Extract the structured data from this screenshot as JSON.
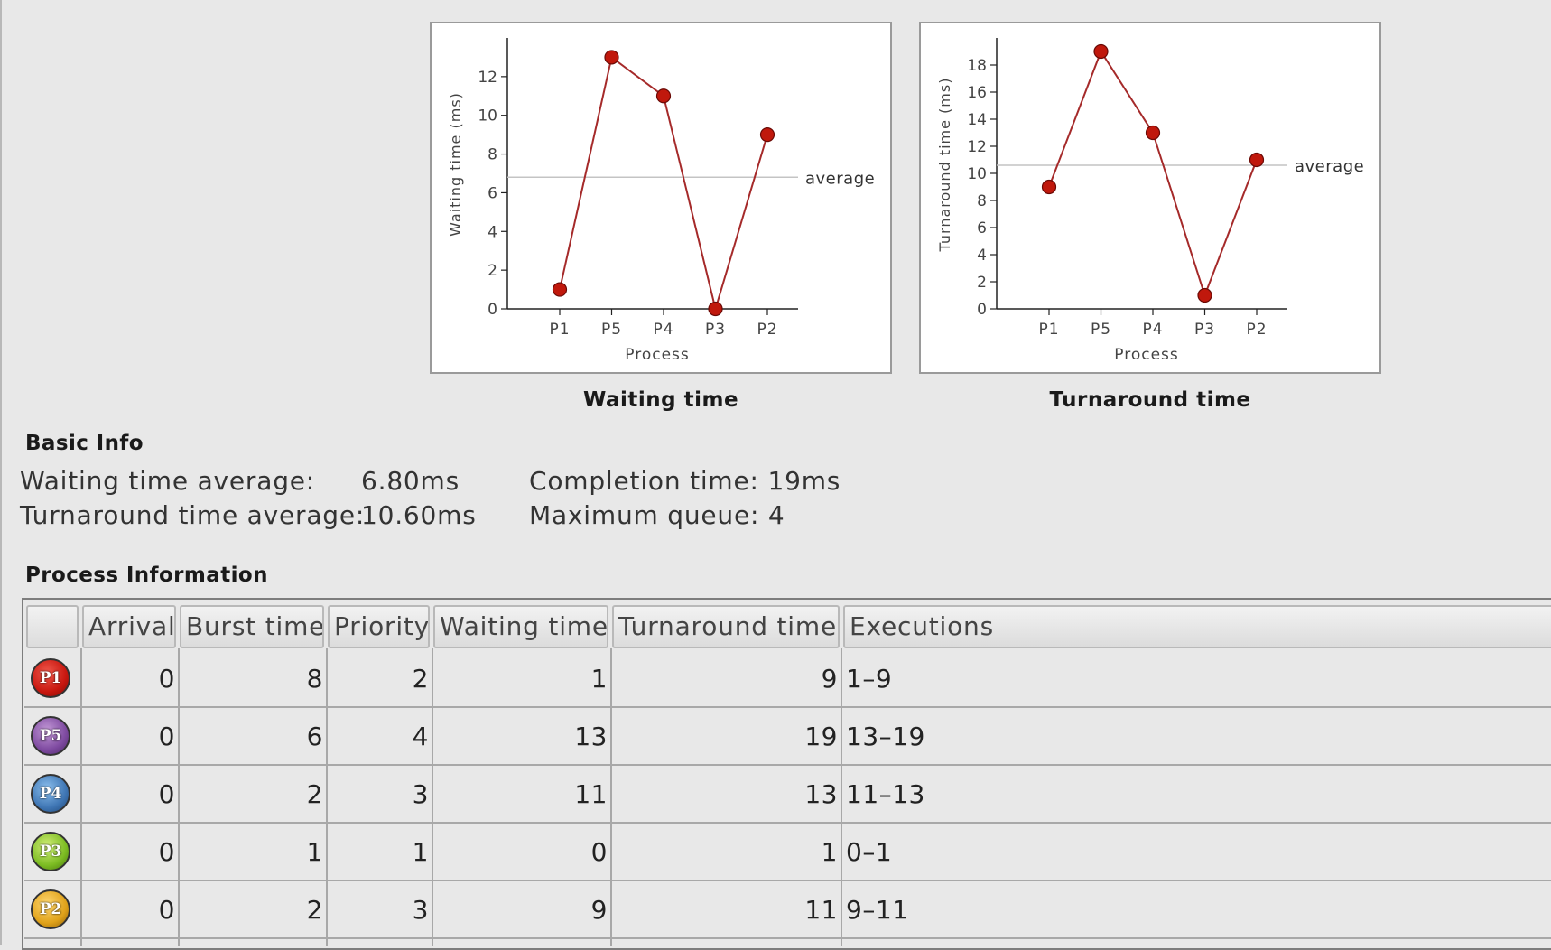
{
  "charts": [
    {
      "caption": "Waiting time",
      "average_label": "average",
      "chart_data": {
        "type": "line",
        "categories": [
          "P1",
          "P5",
          "P4",
          "P3",
          "P2"
        ],
        "values": [
          1,
          13,
          11,
          0,
          9
        ],
        "average": 6.8,
        "xlabel": "Process",
        "ylabel": "Waiting time (ms)",
        "ylim": [
          0,
          14
        ],
        "yticks": [
          0,
          2,
          4,
          6,
          8,
          10,
          12
        ],
        "line_color": "#a52a2a",
        "marker_color": "#c0180c"
      }
    },
    {
      "caption": "Turnaround time",
      "average_label": "average",
      "chart_data": {
        "type": "line",
        "categories": [
          "P1",
          "P5",
          "P4",
          "P3",
          "P2"
        ],
        "values": [
          9,
          19,
          13,
          1,
          11
        ],
        "average": 10.6,
        "xlabel": "Process",
        "ylabel": "Turnaround time (ms)",
        "ylim": [
          0,
          20
        ],
        "yticks": [
          0,
          2,
          4,
          6,
          8,
          10,
          12,
          14,
          16,
          18
        ],
        "line_color": "#a52a2a",
        "marker_color": "#c0180c"
      }
    }
  ],
  "basic_info": {
    "title": "Basic Info",
    "waiting_avg_label": "Waiting time average:",
    "waiting_avg_value": "6.80ms",
    "turnaround_avg_label": "Turnaround time average:",
    "turnaround_avg_value": "10.60ms",
    "completion_time": "Completion time: 19ms",
    "max_queue": "Maximum queue: 4"
  },
  "process_info": {
    "title": "Process Information",
    "headers": [
      "",
      "Arrival",
      "Burst time",
      "Priority",
      "Waiting time",
      "Turnaround time",
      "Executions"
    ],
    "rows": [
      {
        "id": "P1",
        "color": "#c8170f",
        "arrival": "0",
        "burst": "8",
        "priority": "2",
        "waiting": "1",
        "turnaround": "9",
        "executions": "1–9"
      },
      {
        "id": "P5",
        "color": "#7e4aa0",
        "arrival": "0",
        "burst": "6",
        "priority": "4",
        "waiting": "13",
        "turnaround": "19",
        "executions": "13–19"
      },
      {
        "id": "P4",
        "color": "#3f76b4",
        "arrival": "0",
        "burst": "2",
        "priority": "3",
        "waiting": "11",
        "turnaround": "13",
        "executions": "11–13"
      },
      {
        "id": "P3",
        "color": "#7cbc22",
        "arrival": "0",
        "burst": "1",
        "priority": "1",
        "waiting": "0",
        "turnaround": "1",
        "executions": "0–1"
      },
      {
        "id": "P2",
        "color": "#e0a21a",
        "arrival": "0",
        "burst": "2",
        "priority": "3",
        "waiting": "9",
        "turnaround": "11",
        "executions": "9–11"
      }
    ]
  }
}
